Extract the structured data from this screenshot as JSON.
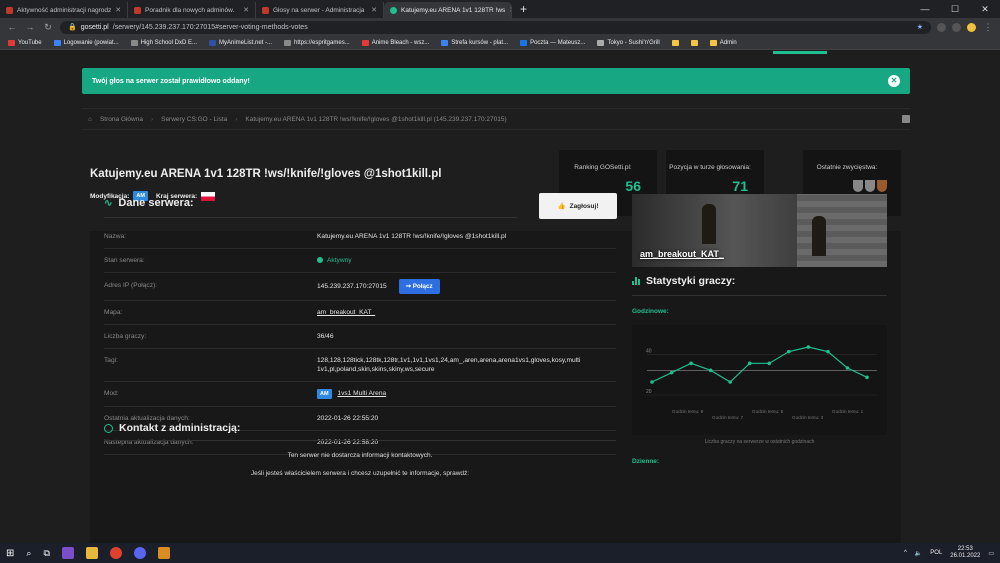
{
  "browser": {
    "tabs": [
      {
        "label": "Aktywność administracji nagrodz"
      },
      {
        "label": "Poradnik dla nowych adminów."
      },
      {
        "label": "Głosy na serwer - Administracja"
      },
      {
        "label": "Katujemy.eu ARENA 1v1 128TR !ws"
      }
    ],
    "new_tab": "+",
    "url_domain": "gosetti.pl",
    "url_path": "/serwery/145.239.237.170:27015#server-voting-methods-votes",
    "bookmarks": [
      "YouTube",
      "Logowanie (powiat...",
      "High School DxD E...",
      "MyAnimeList.net -...",
      "https://espritgames...",
      "Anime Bleach - wsz...",
      "Strefa kursów - plat...",
      "Poczta — Mateusz...",
      "Tokyo - Sushi'n'Grill",
      "",
      "",
      "Admin"
    ]
  },
  "alert": {
    "message": "Twój głos na serwer został prawidłowo oddany!",
    "close": "✕"
  },
  "breadcrumb": {
    "home": "Strona Główna",
    "list": "Serwery CS:GO - Lista",
    "current": "Katujemy.eu ARENA 1v1 128TR !ws/!knife/!gloves @1shot1kill.pl (145.239.237.170:27015)"
  },
  "server": {
    "title": "Katujemy.eu ARENA 1v1 128TR !ws/!knife/!gloves @1shot1kill.pl",
    "mod_label": "Modyfikacja:",
    "mod_badge": "AM",
    "country_label": "Kraj serwera:"
  },
  "stats": {
    "ranking_label": "Ranking GOSetti.pl:",
    "ranking_value": "56",
    "position_label": "Pozycja w turze głosowania:",
    "position_value": "71",
    "wins_label": "Ostatnie zwycięstwa:"
  },
  "details": {
    "heading": "Dane serwera:",
    "vote_button": "Zagłosuj!",
    "rows": [
      {
        "key": "Nazwa:",
        "value": "Katujemy.eu ARENA 1v1 128TR !ws/!knife/!gloves @1shot1kill.pl"
      },
      {
        "key": "Stan serwera:",
        "value": "Aktywny"
      },
      {
        "key": "Adres IP (Połącz):",
        "value": "145.239.237.170:27015"
      },
      {
        "key": "Mapa:",
        "value": "am_breakout_KAT_"
      },
      {
        "key": "Liczba graczy:",
        "value": "36/46"
      },
      {
        "key": "Tagi:",
        "value": "128,128,128tick,128tk,128tr,1v1,1v1,1vs1,24,am_,aren,arena,arena1vs1,gloves,kosy,multi 1v1,pl,poland,skin,skins,skiny,ws,secure"
      },
      {
        "key": "Mod:",
        "value": "1vs1 Multi Arena"
      },
      {
        "key": "Ostatnia aktualizacja danych:",
        "value": "2022-01-26 22:55:20"
      },
      {
        "key": "Nastepna aktualizacja danych:",
        "value": "2022-01-26 22:58:20"
      }
    ],
    "connect_button": "Połącz",
    "mod_badge": "AM"
  },
  "contact": {
    "heading": "Kontakt z administracją:",
    "line1": "Ten serwer nie dostarcza informacji kontaktowych.",
    "line2": "Jeśli jesteś właścicielem serwera i chcesz uzupełnić te informacje, sprawdź:"
  },
  "map_card": {
    "name": "am_breakout_KAT_"
  },
  "player_stats": {
    "heading": "Statystyki graczy:",
    "hourly_label": "Godzinowe:",
    "daily_label": "Dzienne:",
    "caption": "Liczba graczy na serwerze w ostatnich godzinach",
    "colors": {
      "accent": "#1fbf8f"
    }
  },
  "chart_data": {
    "type": "line",
    "title": "Godzinowe:",
    "x": [
      "Godzin temu: 9",
      "Godzin temu: 8",
      "Godzin temu: 7",
      "Godzin temu: 6",
      "Godzin temu: 5",
      "Godzin temu: 4",
      "Godzin temu: 3",
      "Godzin temu: 2",
      "Godzin temu: 1",
      "Godzin temu: 0"
    ],
    "x_ticks": [
      "Godzin temu: 9",
      "Godzin temu: 7",
      "Godzin temu: 5",
      "Godzin temu: 3",
      "Godzin temu: 1"
    ],
    "values": [
      29,
      33,
      37,
      34,
      29,
      37,
      37,
      42,
      44,
      42,
      35,
      31
    ],
    "ylim": [
      20,
      50
    ],
    "y_ticks": [
      20,
      40
    ],
    "grid": true
  },
  "taskbar": {
    "lang": "POL",
    "time": "22:53",
    "date": "26.01.2022"
  }
}
